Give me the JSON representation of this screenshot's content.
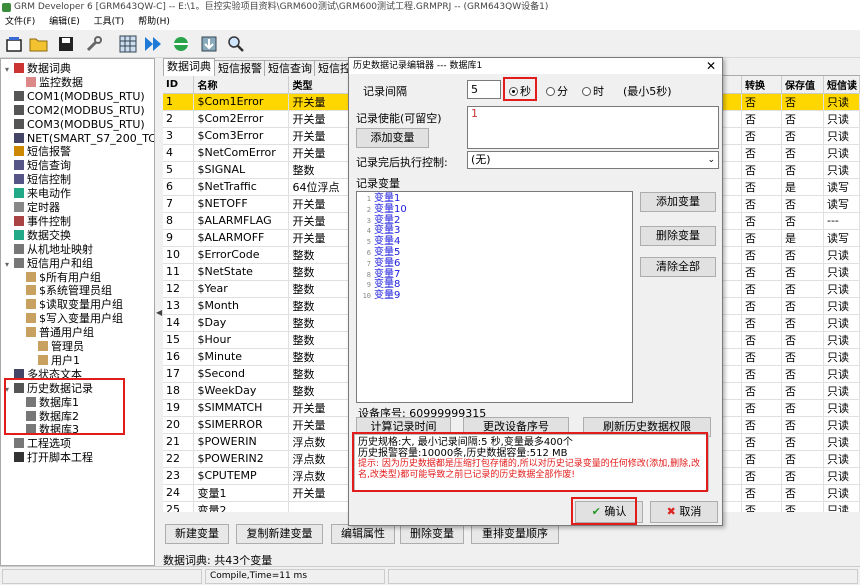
{
  "window": {
    "title": "GRM Developer 6 [GRM643QW-C] -- E:\\1。巨控实验项目资料\\GRM600测试\\GRM600测试工程.GRMPRJ -- (GRM643QW设备1)"
  },
  "menu": [
    "文件(F)",
    "编辑(E)",
    "工具(T)",
    "帮助(H)"
  ],
  "toolbar": {
    "icons": [
      "new-project-icon",
      "open-folder-icon",
      "save-icon",
      "wrench-icon",
      "grid-icon",
      "run-icon",
      "connect-icon",
      "download-icon",
      "search-icon"
    ]
  },
  "tree": [
    {
      "label": "数据词典",
      "level": 0,
      "icon": "book"
    },
    {
      "label": "监控数据",
      "level": 1,
      "icon": "monitor"
    },
    {
      "label": "COM1(MODBUS_RTU)",
      "level": 0,
      "icon": "port"
    },
    {
      "label": "COM2(MODBUS_RTU)",
      "level": 0,
      "icon": "port"
    },
    {
      "label": "COM3(MODBUS_RTU)",
      "level": 0,
      "icon": "port"
    },
    {
      "label": "NET(SMART_S7_200_TCP",
      "level": 0,
      "icon": "net"
    },
    {
      "label": "短信报警",
      "level": 0,
      "icon": "bell"
    },
    {
      "label": "短信查询",
      "level": 0,
      "icon": "sms"
    },
    {
      "label": "短信控制",
      "level": 0,
      "icon": "sms"
    },
    {
      "label": "来电动作",
      "level": 0,
      "icon": "phone"
    },
    {
      "label": "定时器",
      "level": 0,
      "icon": "clock"
    },
    {
      "label": "事件控制",
      "level": 0,
      "icon": "event"
    },
    {
      "label": "数据交换",
      "level": 0,
      "icon": "exchange"
    },
    {
      "label": "从机地址映射",
      "level": 0,
      "icon": "map"
    },
    {
      "label": "短信用户和组",
      "level": 0,
      "icon": "users"
    },
    {
      "label": "$所有用户组",
      "level": 1,
      "icon": "group"
    },
    {
      "label": "$系统管理员组",
      "level": 1,
      "icon": "group"
    },
    {
      "label": "$读取变量用户组",
      "level": 1,
      "icon": "group"
    },
    {
      "label": "$写入变量用户组",
      "level": 1,
      "icon": "group"
    },
    {
      "label": "普通用户组",
      "level": 1,
      "icon": "group"
    },
    {
      "label": "管理员",
      "level": 2,
      "icon": "user"
    },
    {
      "label": "用户1",
      "level": 2,
      "icon": "user"
    },
    {
      "label": "多状态文本",
      "level": 0,
      "icon": "text"
    },
    {
      "label": "历史数据记录",
      "level": 0,
      "icon": "history"
    },
    {
      "label": "数据库1",
      "level": 1,
      "icon": "db"
    },
    {
      "label": "数据库2",
      "level": 1,
      "icon": "db"
    },
    {
      "label": "数据库3",
      "level": 1,
      "icon": "db"
    },
    {
      "label": "工程选项",
      "level": 0,
      "icon": "options"
    },
    {
      "label": "打开脚本工程",
      "level": 0,
      "icon": "script"
    }
  ],
  "tabs": [
    "数据词典",
    "短信报警",
    "短信查询",
    "短信控"
  ],
  "grid": {
    "columns": [
      "ID",
      "名称",
      "类型",
      "",
      "转换",
      "保存值",
      "短信读"
    ],
    "rows": [
      [
        "1",
        "$Com1Error",
        "开关量",
        "",
        "否",
        "否",
        "只读"
      ],
      [
        "2",
        "$Com2Error",
        "开关量",
        "",
        "否",
        "否",
        "只读"
      ],
      [
        "3",
        "$Com3Error",
        "开关量",
        "",
        "否",
        "否",
        "只读"
      ],
      [
        "4",
        "$NetComError",
        "开关量",
        "",
        "否",
        "否",
        "只读"
      ],
      [
        "5",
        "$SIGNAL",
        "整数",
        "",
        "否",
        "否",
        "只读"
      ],
      [
        "6",
        "$NetTraffic",
        "64位浮点",
        "",
        "否",
        "是",
        "读写"
      ],
      [
        "7",
        "$NETOFF",
        "开关量",
        "",
        "否",
        "否",
        "读写"
      ],
      [
        "8",
        "$ALARMFLAG",
        "开关量",
        "",
        "否",
        "否",
        "---"
      ],
      [
        "9",
        "$ALARMOFF",
        "开关量",
        "",
        "否",
        "是",
        "读写"
      ],
      [
        "10",
        "$ErrorCode",
        "整数",
        "",
        "否",
        "否",
        "只读"
      ],
      [
        "11",
        "$NetState",
        "整数",
        "",
        "否",
        "否",
        "只读"
      ],
      [
        "12",
        "$Year",
        "整数",
        "",
        "否",
        "否",
        "只读"
      ],
      [
        "13",
        "$Month",
        "整数",
        "",
        "否",
        "否",
        "只读"
      ],
      [
        "14",
        "$Day",
        "整数",
        "",
        "否",
        "否",
        "只读"
      ],
      [
        "15",
        "$Hour",
        "整数",
        "",
        "否",
        "否",
        "只读"
      ],
      [
        "16",
        "$Minute",
        "整数",
        "",
        "否",
        "否",
        "只读"
      ],
      [
        "17",
        "$Second",
        "整数",
        "",
        "否",
        "否",
        "只读"
      ],
      [
        "18",
        "$WeekDay",
        "整数",
        "",
        "否",
        "否",
        "只读"
      ],
      [
        "19",
        "$SIMMATCH",
        "开关量",
        "",
        "否",
        "否",
        "只读"
      ],
      [
        "20",
        "$SIMERROR",
        "开关量",
        "",
        "否",
        "否",
        "只读"
      ],
      [
        "21",
        "$POWERIN",
        "浮点数",
        "",
        "否",
        "否",
        "只读"
      ],
      [
        "22",
        "$POWERIN2",
        "浮点数",
        "",
        "否",
        "否",
        "只读"
      ],
      [
        "23",
        "$CPUTEMP",
        "浮点数",
        "",
        "否",
        "否",
        "只读"
      ],
      [
        "24",
        "变量1",
        "开关量",
        "",
        "否",
        "否",
        "只读"
      ],
      [
        "25",
        "变量2",
        "",
        "",
        "否",
        "否",
        "只读"
      ]
    ]
  },
  "bottom_buttons": [
    "新建变量",
    "复制新建变量",
    "编辑属性",
    "删除变量",
    "重排变量顺序"
  ],
  "status": {
    "summary": "数据词典: 共43个变量",
    "compile": "Compile,Time=11 ms"
  },
  "dialog": {
    "title": "历史数据记录编辑器 --- 数据库1",
    "interval_label": "记录间隔",
    "interval_value": "5",
    "unit_sec": "秒",
    "unit_min": "分",
    "unit_hour": "时",
    "min_note": "(最小5秒)",
    "enable_label": "记录使能(可留空)",
    "enable_value": "1",
    "add_var_button": "添加变量",
    "after_label": "记录完后执行控制:",
    "after_value": "(无)",
    "vars_label": "记录变量",
    "vars": [
      "变量1",
      "变量10",
      "变量2",
      "变量3",
      "变量4",
      "变量5",
      "变量6",
      "变量7",
      "变量8",
      "变量9"
    ],
    "side_add": "添加变量",
    "side_delete": "删除变量",
    "side_clear": "清除全部",
    "serial": "设备序号: 60999999315",
    "calc_button": "计算记录时间",
    "change_serial_button": "更改设备序号",
    "refresh_button": "刷新历史数据权限",
    "info1": "历史规格:大,  最小记录间隔:5 秒,变量最多400个",
    "info2": "历史报警容量:10000条,历史数据容量:512 MB",
    "warn": "提示: 因为历史数据都是压缩打包存储的,所以对历史记录变量的任何修改(添加,删除,改名,改类型)都可能导致之前已记录的历史数据全部作废!",
    "ok": "确认",
    "cancel": "取消"
  }
}
